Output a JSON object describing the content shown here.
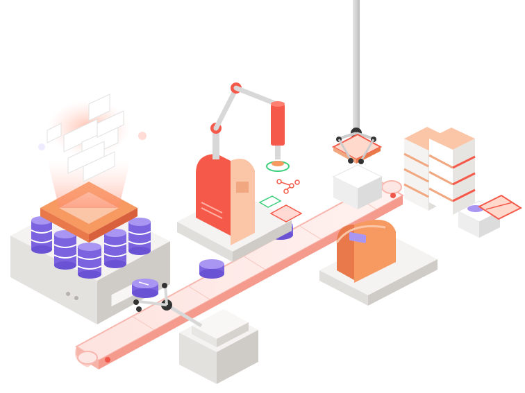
{
  "scene": {
    "description_visible_text": "",
    "colors": {
      "background": "#ffffff",
      "platform_top": "#f4f3f1",
      "platform_side": "#dedcd9",
      "platform_dark": "#cac7c3",
      "belt": "#fde7e4",
      "belt_edge": "#f7b7ae",
      "belt_dot": "#f0564a",
      "purple": "#7b63e0",
      "purple_light": "#a996f2",
      "coral": "#f4594a",
      "coral_dark": "#d9483b",
      "peach": "#fbc6a8",
      "peach_dark": "#f1a77f",
      "orange": "#f79a62",
      "orange_dark": "#e9794a",
      "arm_gray": "#d8d8d8",
      "green": "#3ccf7d"
    },
    "icons": [
      "database-server-icon",
      "robot-arm-icon",
      "conveyor-belt-icon",
      "crane-gripper-icon",
      "box-stack-icon",
      "tunnel-icon",
      "gripper-claw-icon"
    ]
  }
}
